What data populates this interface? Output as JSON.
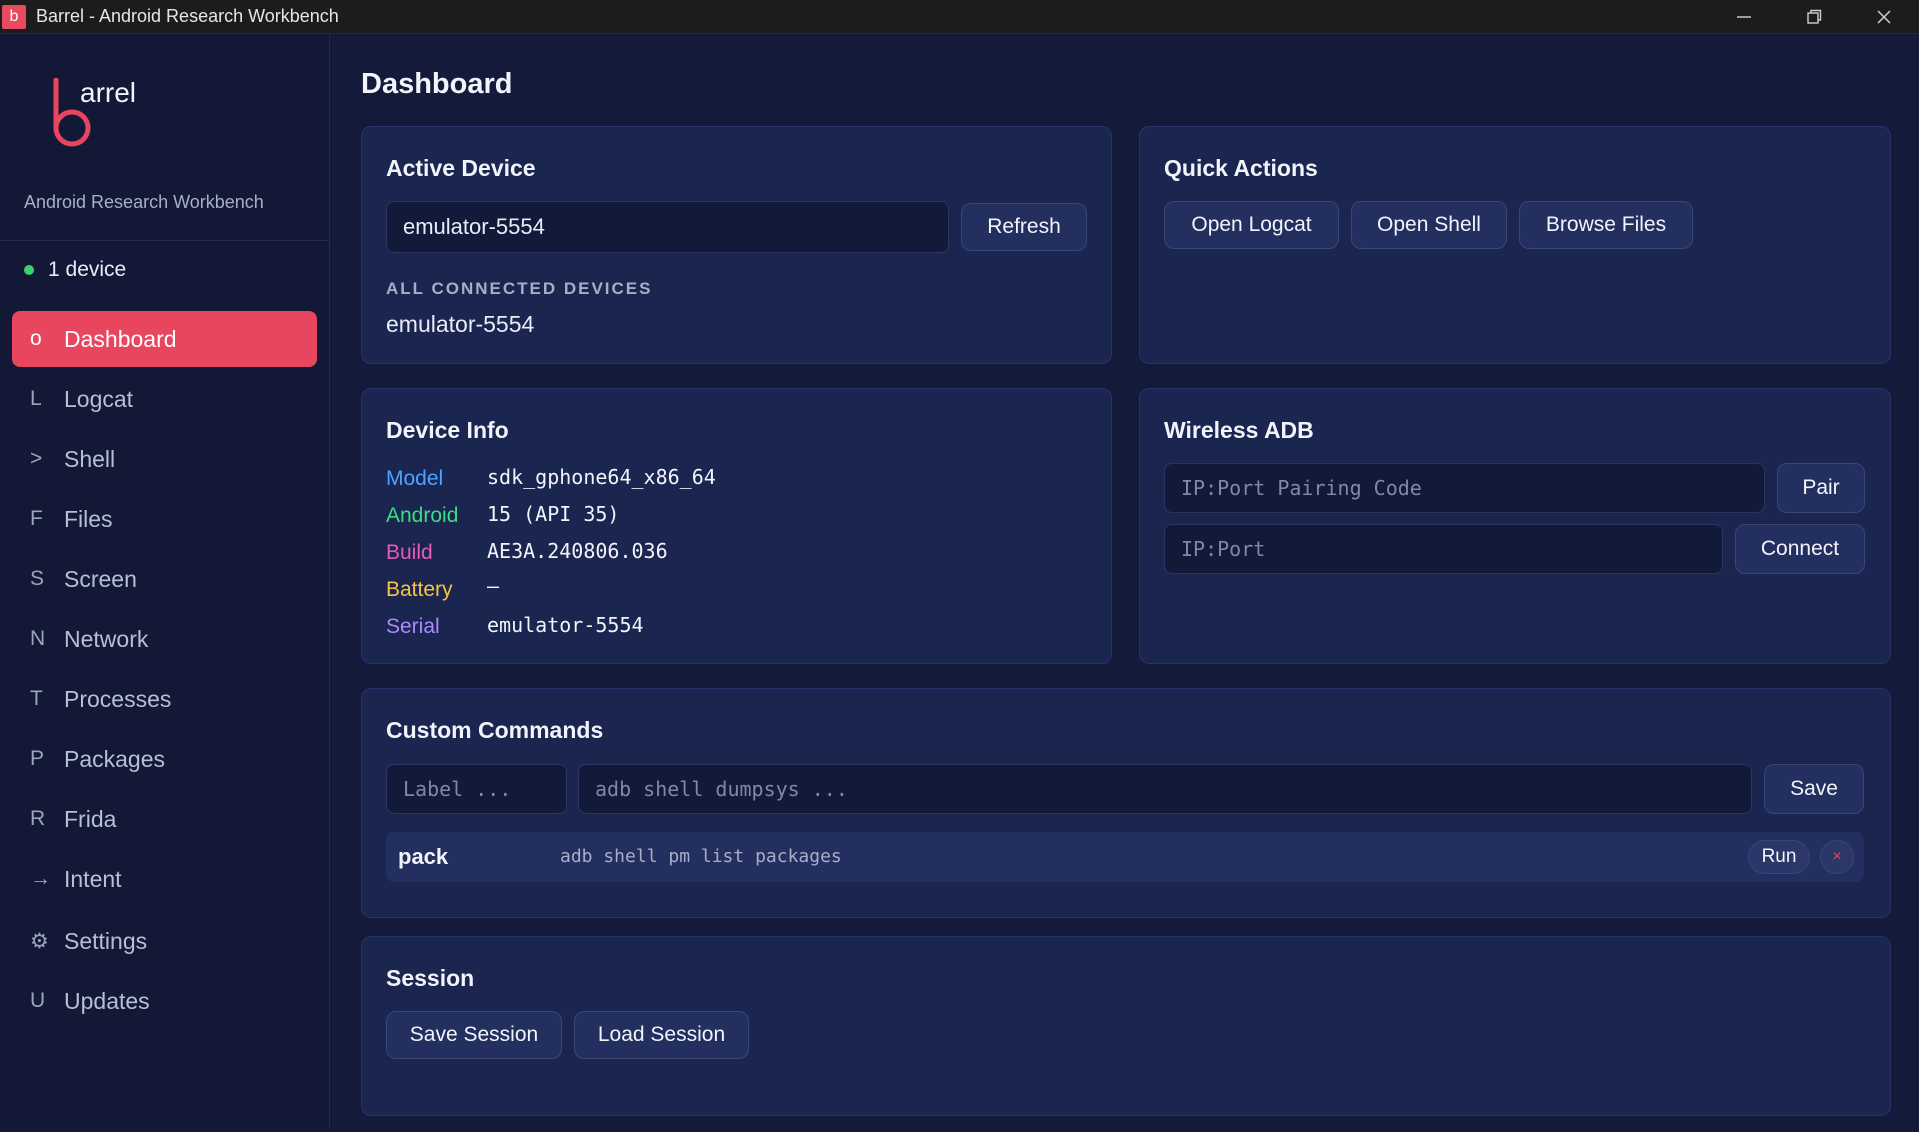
{
  "window": {
    "title": "Barrel - Android Research Workbench",
    "app_icon_letter": "b"
  },
  "sidebar": {
    "logo_text": "arrel",
    "logo_letter": "b",
    "subtitle": "Android Research Workbench",
    "device_status": "1 device",
    "items": [
      {
        "icon": "o",
        "label": "Dashboard",
        "active": true
      },
      {
        "icon": "L",
        "label": "Logcat"
      },
      {
        "icon": ">",
        "label": "Shell"
      },
      {
        "icon": "F",
        "label": "Files"
      },
      {
        "icon": "S",
        "label": "Screen"
      },
      {
        "icon": "N",
        "label": "Network"
      },
      {
        "icon": "T",
        "label": "Processes"
      },
      {
        "icon": "P",
        "label": "Packages"
      },
      {
        "icon": "R",
        "label": "Frida"
      },
      {
        "icon": "→",
        "label": "Intent"
      },
      {
        "icon": "⚙",
        "label": "Settings"
      },
      {
        "icon": "U",
        "label": "Updates"
      }
    ]
  },
  "main": {
    "title": "Dashboard",
    "active_device": {
      "heading": "Active Device",
      "selected": "emulator-5554",
      "refresh_label": "Refresh",
      "connected_heading": "ALL CONNECTED DEVICES",
      "connected": [
        "emulator-5554"
      ]
    },
    "quick_actions": {
      "heading": "Quick Actions",
      "buttons": [
        "Open Logcat",
        "Open Shell",
        "Browse Files"
      ]
    },
    "device_info": {
      "heading": "Device Info",
      "rows": [
        {
          "key": "Model",
          "value": "sdk_gphone64_x86_64",
          "color": "#4da3ff"
        },
        {
          "key": "Android",
          "value": "15 (API 35)",
          "color": "#3ddc84"
        },
        {
          "key": "Build",
          "value": "AE3A.240806.036",
          "color": "#e85ab5"
        },
        {
          "key": "Battery",
          "value": "—",
          "color": "#f5c542"
        },
        {
          "key": "Serial",
          "value": "emulator-5554",
          "color": "#a98bff"
        }
      ]
    },
    "wireless_adb": {
      "heading": "Wireless ADB",
      "pair_placeholder": "IP:Port Pairing Code",
      "pair_label": "Pair",
      "connect_placeholder": "IP:Port",
      "connect_label": "Connect"
    },
    "custom_commands": {
      "heading": "Custom Commands",
      "label_placeholder": "Label ...",
      "command_placeholder": "adb shell dumpsys ...",
      "save_label": "Save",
      "commands": [
        {
          "label": "pack",
          "command": "adb shell pm list packages",
          "run_label": "Run",
          "delete_label": "×"
        }
      ]
    },
    "session": {
      "heading": "Session",
      "save_label": "Save Session",
      "load_label": "Load Session"
    }
  },
  "colors": {
    "accent": "#e8465f",
    "status_online": "#3bd16f"
  }
}
